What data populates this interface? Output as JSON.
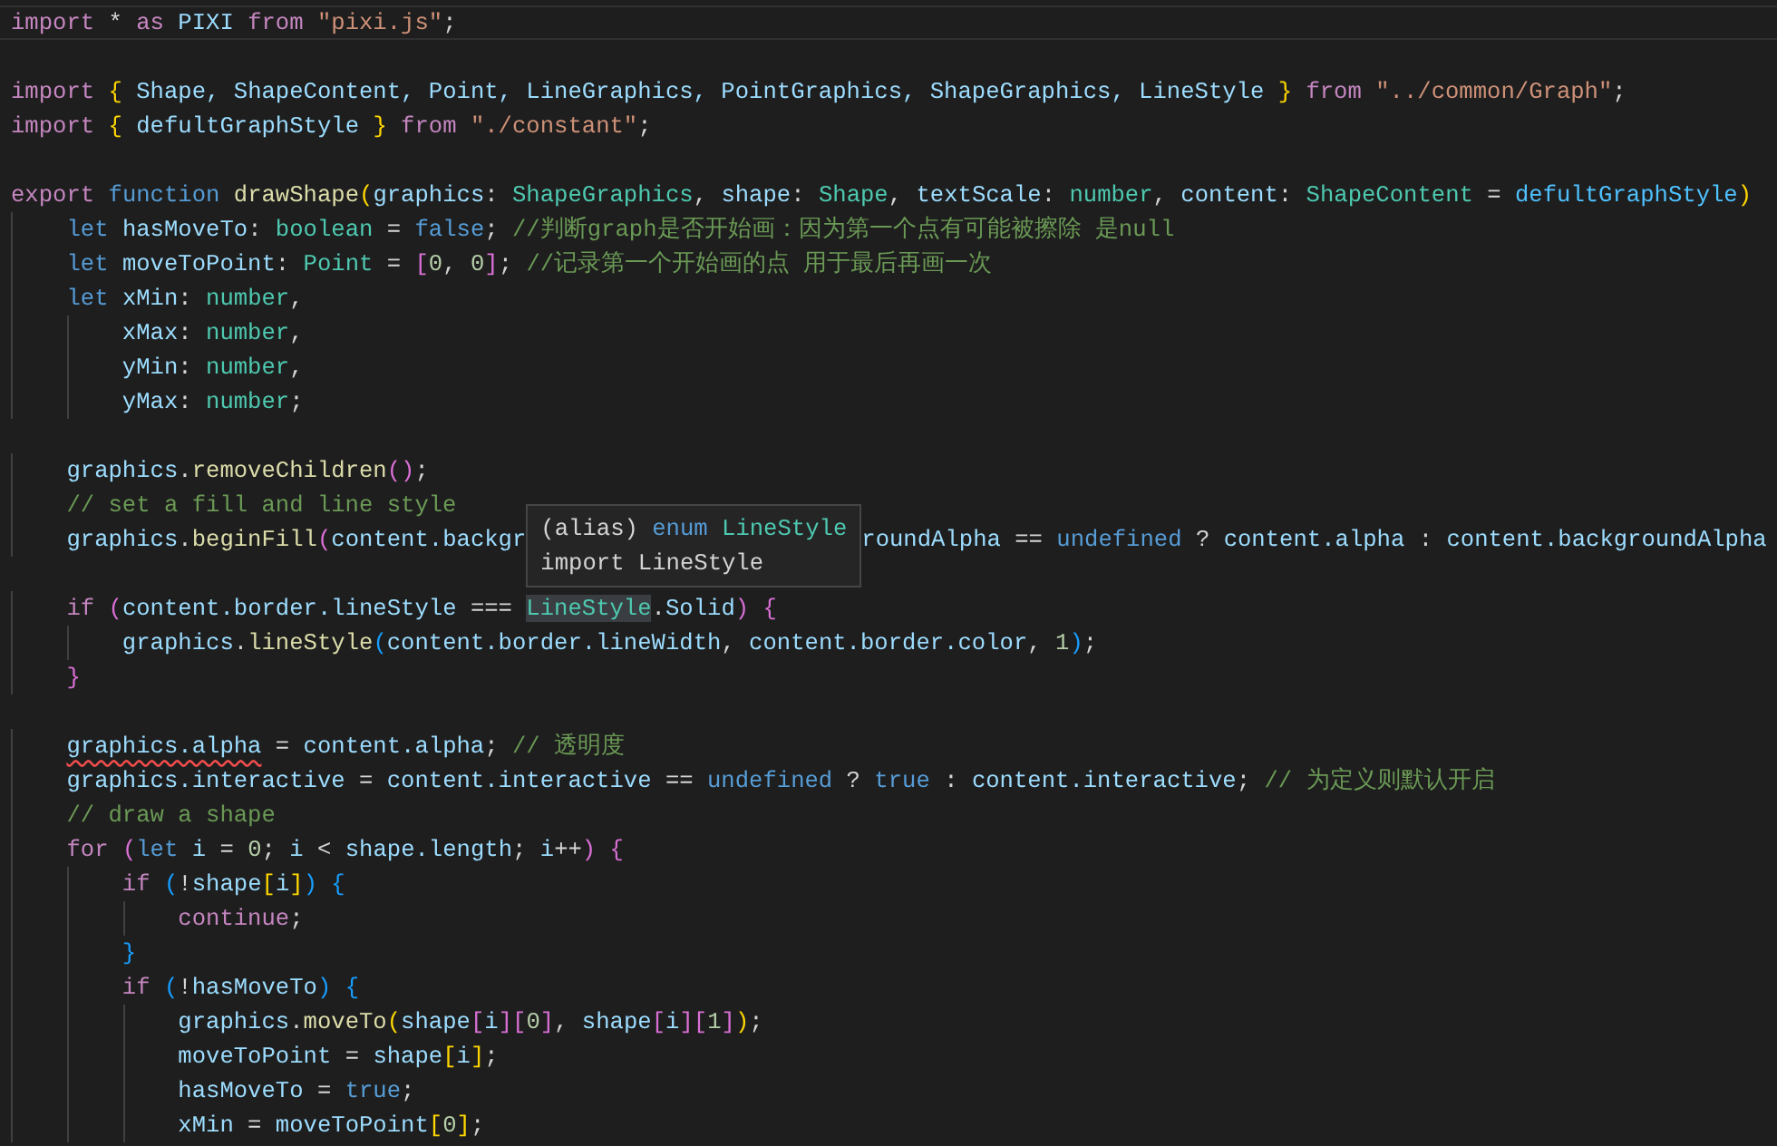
{
  "editor": {
    "lines": [
      {
        "current": true,
        "tokens": [
          {
            "kind": "kw",
            "text": "import"
          },
          {
            "kind": "op",
            "text": " * "
          },
          {
            "kind": "kw",
            "text": "as"
          },
          {
            "kind": "var",
            "text": " PIXI "
          },
          {
            "kind": "kw",
            "text": "from "
          },
          {
            "kind": "str",
            "text": "\"pixi.js\""
          },
          {
            "kind": "op",
            "text": ";"
          }
        ]
      },
      {
        "current": false
      },
      {
        "current": false,
        "tokens": [
          {
            "kind": "kw",
            "text": "import "
          },
          {
            "kind": "b1",
            "text": "{"
          },
          {
            "kind": "var",
            "text": " Shape, ShapeContent, Point, LineGraphics, PointGraphics, ShapeGraphics, LineStyle "
          },
          {
            "kind": "b1",
            "text": "} "
          },
          {
            "kind": "kw",
            "text": "from "
          },
          {
            "kind": "str",
            "text": "\"../common/Graph\""
          },
          {
            "kind": "op",
            "text": ";"
          }
        ]
      },
      {
        "current": false,
        "tokens": [
          {
            "kind": "kw",
            "text": "import "
          },
          {
            "kind": "b1",
            "text": "{"
          },
          {
            "kind": "var",
            "text": " defultGraphStyle "
          },
          {
            "kind": "b1",
            "text": "} "
          },
          {
            "kind": "kw",
            "text": "from "
          },
          {
            "kind": "str",
            "text": "\"./constant\""
          },
          {
            "kind": "op",
            "text": ";"
          }
        ]
      },
      {
        "current": false
      },
      {
        "current": false,
        "tokens": [
          {
            "kind": "kw",
            "text": "export "
          },
          {
            "kind": "decl",
            "text": "function "
          },
          {
            "kind": "fn",
            "text": "drawShape"
          },
          {
            "kind": "b1",
            "text": "("
          },
          {
            "kind": "var",
            "text": "graphics"
          },
          {
            "kind": "op",
            "text": ": "
          },
          {
            "kind": "type",
            "text": "ShapeGraphics"
          },
          {
            "kind": "op",
            "text": ", "
          },
          {
            "kind": "var",
            "text": "shape"
          },
          {
            "kind": "op",
            "text": ": "
          },
          {
            "kind": "type",
            "text": "Shape"
          },
          {
            "kind": "op",
            "text": ", "
          },
          {
            "kind": "var",
            "text": "textScale"
          },
          {
            "kind": "op",
            "text": ": "
          },
          {
            "kind": "type",
            "text": "number"
          },
          {
            "kind": "op",
            "text": ", "
          },
          {
            "kind": "var",
            "text": "content"
          },
          {
            "kind": "op",
            "text": ": "
          },
          {
            "kind": "type",
            "text": "ShapeContent"
          },
          {
            "kind": "op",
            "text": " = "
          },
          {
            "kind": "const",
            "text": "defultGraphStyle"
          },
          {
            "kind": "b1",
            "text": ")"
          }
        ]
      },
      {
        "current": false,
        "tokens": [
          {
            "kind": "decl",
            "text": "    let"
          },
          {
            "kind": "var",
            "text": " hasMoveTo"
          },
          {
            "kind": "op",
            "text": ": "
          },
          {
            "kind": "type",
            "text": "boolean"
          },
          {
            "kind": "op",
            "text": " = "
          },
          {
            "kind": "decl",
            "text": "false"
          },
          {
            "kind": "op",
            "text": "; "
          },
          {
            "kind": "cmt",
            "text": "//判断graph是否开始画：因为第一个点有可能被擦除 是null"
          }
        ]
      },
      {
        "current": false,
        "tokens": [
          {
            "kind": "decl",
            "text": "    let"
          },
          {
            "kind": "var",
            "text": " moveToPoint"
          },
          {
            "kind": "op",
            "text": ": "
          },
          {
            "kind": "type",
            "text": "Point"
          },
          {
            "kind": "op",
            "text": " = "
          },
          {
            "kind": "b2",
            "text": "["
          },
          {
            "kind": "num",
            "text": "0"
          },
          {
            "kind": "op",
            "text": ", "
          },
          {
            "kind": "num",
            "text": "0"
          },
          {
            "kind": "b2",
            "text": "]"
          },
          {
            "kind": "op",
            "text": "; "
          },
          {
            "kind": "cmt",
            "text": "//记录第一个开始画的点 用于最后再画一次"
          }
        ]
      },
      {
        "current": false,
        "tokens": [
          {
            "kind": "decl",
            "text": "    let"
          },
          {
            "kind": "var",
            "text": " xMin"
          },
          {
            "kind": "op",
            "text": ": "
          },
          {
            "kind": "type",
            "text": "number"
          },
          {
            "kind": "op",
            "text": ","
          }
        ]
      },
      {
        "current": false,
        "tokens": [
          {
            "kind": "var",
            "text": "        xMax"
          },
          {
            "kind": "op",
            "text": ": "
          },
          {
            "kind": "type",
            "text": "number"
          },
          {
            "kind": "op",
            "text": ","
          }
        ]
      },
      {
        "current": false,
        "tokens": [
          {
            "kind": "var",
            "text": "        yMin"
          },
          {
            "kind": "op",
            "text": ": "
          },
          {
            "kind": "type",
            "text": "number"
          },
          {
            "kind": "op",
            "text": ","
          }
        ]
      },
      {
        "current": false,
        "tokens": [
          {
            "kind": "var",
            "text": "        yMax"
          },
          {
            "kind": "op",
            "text": ": "
          },
          {
            "kind": "type",
            "text": "number"
          },
          {
            "kind": "op",
            "text": ";"
          }
        ]
      },
      {
        "current": false
      },
      {
        "current": false,
        "tokens": [
          {
            "kind": "var",
            "text": "    graphics"
          },
          {
            "kind": "op",
            "text": "."
          },
          {
            "kind": "fn",
            "text": "removeChildren"
          },
          {
            "kind": "b2",
            "text": "()"
          },
          {
            "kind": "op",
            "text": ";"
          }
        ]
      },
      {
        "current": false,
        "tokens": [
          {
            "kind": "cmt",
            "text": "    // set a fill and line style"
          }
        ]
      },
      {
        "current": false,
        "tokens": [
          {
            "kind": "var",
            "text": "    graphics"
          },
          {
            "kind": "op",
            "text": "."
          },
          {
            "kind": "fn",
            "text": "beginFill"
          },
          {
            "kind": "b2",
            "text": "("
          },
          {
            "kind": "var",
            "text": "content.backgr"
          }
        ],
        "hover_tip": {
          "lines": [
            [
              {
                "kind": "op",
                "text": "(alias) "
              },
              {
                "kind": "decl",
                "text": "enum "
              },
              {
                "kind": "type",
                "text": "LineStyle"
              }
            ],
            [
              {
                "kind": "op",
                "text": "import LineStyle"
              }
            ]
          ]
        },
        "tokens_after": [
          {
            "kind": "var",
            "text": "roundAlpha"
          },
          {
            "kind": "op",
            "text": " == "
          },
          {
            "kind": "decl",
            "text": "undefined"
          },
          {
            "kind": "op",
            "text": " ? "
          },
          {
            "kind": "var",
            "text": "content.alpha"
          },
          {
            "kind": "op",
            "text": " : "
          },
          {
            "kind": "var",
            "text": "content.backgroundAlpha"
          }
        ]
      },
      {
        "current": false
      },
      {
        "current": false,
        "tokens": [
          {
            "kind": "kw",
            "text": "    if "
          },
          {
            "kind": "b2",
            "text": "("
          },
          {
            "kind": "var",
            "text": "content.border.lineStyle"
          },
          {
            "kind": "op",
            "text": " === "
          },
          {
            "kind": "type",
            "text": "LineStyle",
            "highlighted": true
          },
          {
            "kind": "op",
            "text": "."
          },
          {
            "kind": "var",
            "text": "Solid"
          },
          {
            "kind": "b2",
            "text": ") {"
          }
        ]
      },
      {
        "current": false,
        "tokens": [
          {
            "kind": "var",
            "text": "        graphics"
          },
          {
            "kind": "op",
            "text": "."
          },
          {
            "kind": "fn",
            "text": "lineStyle"
          },
          {
            "kind": "b3",
            "text": "("
          },
          {
            "kind": "var",
            "text": "content.border.lineWidth"
          },
          {
            "kind": "op",
            "text": ", "
          },
          {
            "kind": "var",
            "text": "content.border.color"
          },
          {
            "kind": "op",
            "text": ", "
          },
          {
            "kind": "num",
            "text": "1"
          },
          {
            "kind": "b3",
            "text": ")"
          },
          {
            "kind": "op",
            "text": ";"
          }
        ]
      },
      {
        "current": false,
        "tokens": [
          {
            "kind": "b2",
            "text": "    }"
          }
        ]
      },
      {
        "current": false
      },
      {
        "current": false,
        "tokens": [
          {
            "kind": "var",
            "text": "    graphics.alpha",
            "error": true
          },
          {
            "kind": "op",
            "text": " = "
          },
          {
            "kind": "var",
            "text": "content.alpha"
          },
          {
            "kind": "op",
            "text": "; "
          },
          {
            "kind": "cmt",
            "text": "// 透明度"
          }
        ]
      },
      {
        "current": false,
        "tokens": [
          {
            "kind": "var",
            "text": "    graphics.interactive"
          },
          {
            "kind": "op",
            "text": " = "
          },
          {
            "kind": "var",
            "text": "content.interactive"
          },
          {
            "kind": "op",
            "text": " == "
          },
          {
            "kind": "decl",
            "text": "undefined"
          },
          {
            "kind": "op",
            "text": " ? "
          },
          {
            "kind": "decl",
            "text": "true"
          },
          {
            "kind": "op",
            "text": " : "
          },
          {
            "kind": "var",
            "text": "content.interactive"
          },
          {
            "kind": "op",
            "text": "; "
          },
          {
            "kind": "cmt",
            "text": "// 为定义则默认开启"
          }
        ]
      },
      {
        "current": false,
        "tokens": [
          {
            "kind": "cmt",
            "text": "    // draw a shape"
          }
        ]
      },
      {
        "current": false,
        "tokens": [
          {
            "kind": "kw",
            "text": "    for "
          },
          {
            "kind": "b2",
            "text": "("
          },
          {
            "kind": "decl",
            "text": "let"
          },
          {
            "kind": "var",
            "text": " i"
          },
          {
            "kind": "op",
            "text": " = "
          },
          {
            "kind": "num",
            "text": "0"
          },
          {
            "kind": "op",
            "text": "; "
          },
          {
            "kind": "var",
            "text": "i"
          },
          {
            "kind": "op",
            "text": " < "
          },
          {
            "kind": "var",
            "text": "shape.length"
          },
          {
            "kind": "op",
            "text": "; "
          },
          {
            "kind": "var",
            "text": "i"
          },
          {
            "kind": "op",
            "text": "++"
          },
          {
            "kind": "b2",
            "text": ") {"
          }
        ]
      },
      {
        "current": false,
        "tokens": [
          {
            "kind": "kw",
            "text": "        if "
          },
          {
            "kind": "b3",
            "text": "("
          },
          {
            "kind": "op",
            "text": "!"
          },
          {
            "kind": "var",
            "text": "shape"
          },
          {
            "kind": "b1",
            "text": "["
          },
          {
            "kind": "var",
            "text": "i"
          },
          {
            "kind": "b1",
            "text": "]"
          },
          {
            "kind": "b3",
            "text": ") {"
          }
        ]
      },
      {
        "current": false,
        "tokens": [
          {
            "kind": "kw",
            "text": "            continue"
          },
          {
            "kind": "op",
            "text": ";"
          }
        ]
      },
      {
        "current": false,
        "tokens": [
          {
            "kind": "b3",
            "text": "        }"
          }
        ]
      },
      {
        "current": false,
        "tokens": [
          {
            "kind": "kw",
            "text": "        if "
          },
          {
            "kind": "b3",
            "text": "("
          },
          {
            "kind": "op",
            "text": "!"
          },
          {
            "kind": "var",
            "text": "hasMoveTo"
          },
          {
            "kind": "b3",
            "text": ") {"
          }
        ]
      },
      {
        "current": false,
        "tokens": [
          {
            "kind": "var",
            "text": "            graphics"
          },
          {
            "kind": "op",
            "text": "."
          },
          {
            "kind": "fn",
            "text": "moveTo"
          },
          {
            "kind": "b1",
            "text": "("
          },
          {
            "kind": "var",
            "text": "shape"
          },
          {
            "kind": "b2",
            "text": "["
          },
          {
            "kind": "var",
            "text": "i"
          },
          {
            "kind": "b2",
            "text": "]["
          },
          {
            "kind": "num",
            "text": "0"
          },
          {
            "kind": "b2",
            "text": "]"
          },
          {
            "kind": "op",
            "text": ", "
          },
          {
            "kind": "var",
            "text": "shape"
          },
          {
            "kind": "b2",
            "text": "["
          },
          {
            "kind": "var",
            "text": "i"
          },
          {
            "kind": "b2",
            "text": "]["
          },
          {
            "kind": "num",
            "text": "1"
          },
          {
            "kind": "b2",
            "text": "]"
          },
          {
            "kind": "b1",
            "text": ")"
          },
          {
            "kind": "op",
            "text": ";"
          }
        ]
      },
      {
        "current": false,
        "tokens": [
          {
            "kind": "var",
            "text": "            moveToPoint"
          },
          {
            "kind": "op",
            "text": " = "
          },
          {
            "kind": "var",
            "text": "shape"
          },
          {
            "kind": "b1",
            "text": "["
          },
          {
            "kind": "var",
            "text": "i"
          },
          {
            "kind": "b1",
            "text": "]"
          },
          {
            "kind": "op",
            "text": ";"
          }
        ]
      },
      {
        "current": false,
        "tokens": [
          {
            "kind": "var",
            "text": "            hasMoveTo"
          },
          {
            "kind": "op",
            "text": " = "
          },
          {
            "kind": "decl",
            "text": "true"
          },
          {
            "kind": "op",
            "text": ";"
          }
        ]
      },
      {
        "current": false,
        "tokens": [
          {
            "kind": "var",
            "text": "            xMin"
          },
          {
            "kind": "op",
            "text": " = "
          },
          {
            "kind": "var",
            "text": "moveToPoint"
          },
          {
            "kind": "b1",
            "text": "["
          },
          {
            "kind": "num",
            "text": "0"
          },
          {
            "kind": "b1",
            "text": "]"
          },
          {
            "kind": "op",
            "text": ";"
          }
        ]
      }
    ]
  }
}
